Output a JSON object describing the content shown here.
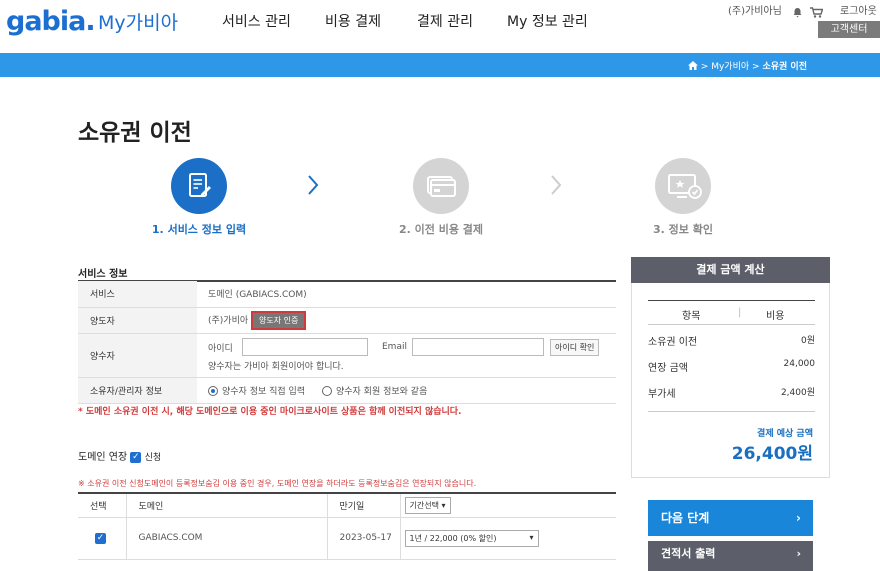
{
  "header": {
    "logo": "gabia.",
    "logo_sub": "My가비아",
    "nav": [
      "서비스 관리",
      "비용 결제",
      "결제 관리",
      "My 정보 관리"
    ],
    "user_name": "(주)가비아님",
    "logout": "로그아웃",
    "customer_center": "고객센터"
  },
  "breadcrumb": {
    "items": [
      "My가비아",
      "소유권 이전"
    ],
    "sep": ">"
  },
  "page_title": "소유권 이전",
  "steps": [
    {
      "label": "1. 서비스 정보 입력",
      "active": true
    },
    {
      "label": "2. 이전 비용 결제",
      "active": false
    },
    {
      "label": "3. 정보 확인",
      "active": false
    }
  ],
  "service_info": {
    "section_title": "서비스 정보",
    "rows": {
      "service_label": "서비스",
      "service_value": "도메인 (GABIACS.COM)",
      "transferor_label": "양도자",
      "transferor_value": "(주)가비아",
      "transferor_btn": "양도자 인증",
      "transferee_label": "양수자",
      "id_label": "아이디",
      "email_label": "Email",
      "id_check_btn": "아이디 확인",
      "transferee_note": "양수자는 가비아 회원이어야 합니다.",
      "owner_label": "소유자/관리자 정보",
      "option_direct": "양수자 정보 직접 입력",
      "option_same": "양수자 회원 정보와 같음"
    },
    "warning": "* 도메인 소유권 이전 시, 해당 도메인으로 이용 중인 마이크로사이트 상품은 함께 이전되지 않습니다."
  },
  "domain_extension": {
    "title": "도메인 연장",
    "checkbox_label": "신청",
    "checked": true,
    "notice": "※ 소유권 이전 신청도메인이 등록정보숨김 이용 중인 경우, 도메인 연장을 하더라도 등록정보숨김은 연장되지 않습니다.",
    "columns": [
      "선택",
      "도메인",
      "만기일",
      "기간선택"
    ],
    "rows": [
      {
        "domain": "GABIACS.COM",
        "expiry": "2023-05-17",
        "period": "1년 / 22,000 (0% 할인)",
        "selected": true
      }
    ]
  },
  "sidebar": {
    "title": "결제 금액 계산",
    "col_item": "항목",
    "col_cost": "비용",
    "rows": [
      {
        "label": "소유권 이전",
        "value": "0원"
      },
      {
        "label": "연장 금액",
        "value": "24,000"
      },
      {
        "label": "부가세",
        "value": "2,400원"
      }
    ],
    "total_label": "결제 예상 금액",
    "total_value": "26,400원",
    "next_btn": "다음 단계",
    "quote_btn": "견적서 출력"
  },
  "colors": {
    "brand": "#1c6fd1",
    "bar": "#2f97e8",
    "accent": "#1a86d9",
    "warning": "#d13a3a"
  }
}
